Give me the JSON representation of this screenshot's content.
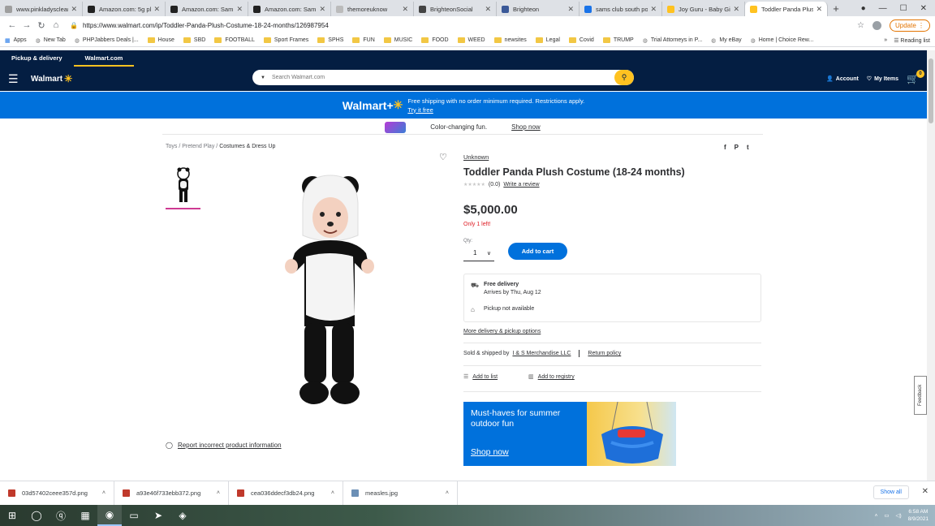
{
  "browser": {
    "tabs": [
      {
        "title": "www.pinkladyscleaners",
        "fav": "#9e9e9e"
      },
      {
        "title": "Amazon.com: 5g pl",
        "fav": "#222"
      },
      {
        "title": "Amazon.com: Sam",
        "fav": "#222"
      },
      {
        "title": "Amazon.com: Sam",
        "fav": "#222"
      },
      {
        "title": "themoreuknow",
        "fav": "#bbb"
      },
      {
        "title": "BrighteonSocial",
        "fav": "#444"
      },
      {
        "title": "Brighteon",
        "fav": "#3b5998"
      },
      {
        "title": "sams club south po",
        "fav": "#1a73e8"
      },
      {
        "title": "Joy Guru - Baby Gi",
        "fav": "#ffc220"
      },
      {
        "title": "Toddler Panda Plus",
        "fav": "#ffc220"
      }
    ],
    "new_tab_symbol": "+",
    "url": "https://www.walmart.com/ip/Toddler-Panda-Plush-Costume-18-24-months/126987954",
    "update_label": "Update",
    "bookmarks": [
      {
        "label": "Apps",
        "type": "apps"
      },
      {
        "label": "New Tab",
        "type": "page"
      },
      {
        "label": "PHPJabbers Deals |...",
        "type": "page"
      },
      {
        "label": "House",
        "type": "folder"
      },
      {
        "label": "SBD",
        "type": "folder"
      },
      {
        "label": "FOOTBALL",
        "type": "folder"
      },
      {
        "label": "Sport Frames",
        "type": "folder"
      },
      {
        "label": "SPHS",
        "type": "folder"
      },
      {
        "label": "FUN",
        "type": "folder"
      },
      {
        "label": "MUSIC",
        "type": "folder"
      },
      {
        "label": "FOOD",
        "type": "folder"
      },
      {
        "label": "WEED",
        "type": "folder"
      },
      {
        "label": "newsites",
        "type": "folder"
      },
      {
        "label": "Legal",
        "type": "folder"
      },
      {
        "label": "Covid",
        "type": "folder"
      },
      {
        "label": "TRUMP",
        "type": "folder"
      },
      {
        "label": "Trial Attorneys in P...",
        "type": "page"
      },
      {
        "label": "My eBay",
        "type": "page"
      },
      {
        "label": "Home | Choice Rew...",
        "type": "page"
      }
    ],
    "reading_list": "Reading list"
  },
  "walmart": {
    "top_links": [
      "Pickup & delivery",
      "Walmart.com"
    ],
    "logo_text": "Walmart",
    "search_placeholder": "Search Walmart.com",
    "account_label": "Account",
    "my_items_label": "My Items",
    "cart_count": "0",
    "promo_logo": "Walmart+",
    "promo_text": "Free shipping with no order minimum required. Restrictions apply.",
    "promo_link": "Try it free",
    "subpromo_text": "Color-changing fun.",
    "subpromo_link": "Shop now",
    "breadcrumbs": [
      "Toys",
      "Pretend Play",
      "Costumes & Dress Up"
    ],
    "report_label": "Report incorrect product information",
    "product": {
      "brand": "Unknown",
      "title": "Toddler Panda Plush Costume (18-24 months)",
      "rating_count": "(0.0)",
      "write_review": "Write a review",
      "price": "$5,000.00",
      "stock": "Only 1 left!",
      "qty_label": "Qty:",
      "qty_value": "1",
      "add_to_cart": "Add to cart",
      "delivery_title": "Free delivery",
      "delivery_date": "Arrives by Thu, Aug 12",
      "pickup": "Pickup not available",
      "more_delivery": "More delivery & pickup options",
      "sold_prefix": "Sold & shipped by",
      "seller": "I & S Merchandise LLC",
      "return_policy": "Return policy",
      "add_to_list": "Add to list",
      "add_to_registry": "Add to registry"
    },
    "ad": {
      "headline": "Must-haves for summer outdoor fun",
      "cta": "Shop now"
    },
    "feedback_label": "Feedback"
  },
  "downloads": {
    "items": [
      {
        "name": "03d57402ceee357d.png",
        "type": "png"
      },
      {
        "name": "a93e46f733ebb372.png",
        "type": "png"
      },
      {
        "name": "cea036ddecf3db24.png",
        "type": "png"
      },
      {
        "name": "measles.jpg",
        "type": "jpg"
      }
    ],
    "show_all": "Show all"
  },
  "taskbar": {
    "time": "6:58 AM",
    "date": "8/9/2021"
  },
  "colors": {
    "walmart_navy": "#041e42",
    "walmart_blue": "#0071dc",
    "walmart_yellow": "#ffc220",
    "stock_red": "#de1c24"
  }
}
